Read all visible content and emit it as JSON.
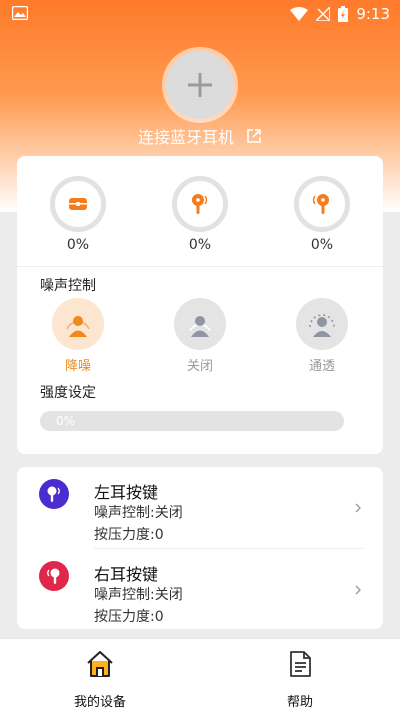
{
  "status_bar": {
    "time": "9:13"
  },
  "header": {
    "connect_label": "连接蓝牙耳机"
  },
  "battery": [
    {
      "name": "case",
      "percent": "0%"
    },
    {
      "name": "left",
      "percent": "0%"
    },
    {
      "name": "right",
      "percent": "0%"
    }
  ],
  "noise_control": {
    "title": "噪声控制",
    "modes": [
      {
        "label": "降噪",
        "active": true
      },
      {
        "label": "关闭",
        "active": false
      },
      {
        "label": "通透",
        "active": false
      }
    ]
  },
  "intensity": {
    "title": "强度设定",
    "value": "0%"
  },
  "keys": [
    {
      "title": "左耳按键",
      "noise_line": "噪声控制:关闭",
      "pressure_line": "按压力度:0"
    },
    {
      "title": "右耳按键",
      "noise_line": "噪声控制:关闭",
      "pressure_line": "按压力度:0"
    }
  ],
  "tabs": [
    {
      "label": "我的设备"
    },
    {
      "label": "帮助"
    }
  ],
  "colors": {
    "accent": "#ff7a2a",
    "active_mode": "#f08a1a",
    "left_key": "#4b2ccf",
    "right_key": "#e0264a"
  }
}
